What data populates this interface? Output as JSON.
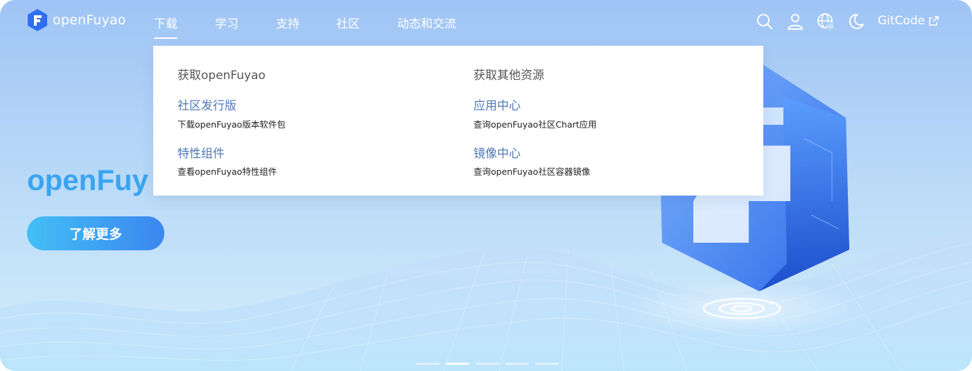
{
  "brand": {
    "name": "openFuyao"
  },
  "nav": {
    "items": [
      {
        "label": "下载",
        "active": true
      },
      {
        "label": "学习",
        "active": false
      },
      {
        "label": "支持",
        "active": false
      },
      {
        "label": "社区",
        "active": false
      },
      {
        "label": "动态和交流",
        "active": false
      }
    ],
    "icons": [
      "search-icon",
      "user-icon",
      "language-icon",
      "dark-mode-icon"
    ],
    "gitcode": "GitCode"
  },
  "dropdown": {
    "left": {
      "title": "获取openFuyao",
      "links": [
        {
          "title": "社区发行版",
          "desc": "下载openFuyao版本软件包"
        },
        {
          "title": "特性组件",
          "desc": "查看openFuyao特性组件"
        }
      ]
    },
    "right": {
      "title": "获取其他资源",
      "links": [
        {
          "title": "应用中心",
          "desc": "查询openFuyao社区Chart应用"
        },
        {
          "title": "镜像中心",
          "desc": "查询openFuyao社区容器镜像"
        }
      ]
    }
  },
  "hero": {
    "title": "openFuy",
    "button": "了解更多"
  },
  "carousel": {
    "count": 5,
    "active_index": 1
  },
  "colors": {
    "accent": "#3b86f0",
    "link": "#4f79b8",
    "hero_title": "#3aa4ee"
  }
}
